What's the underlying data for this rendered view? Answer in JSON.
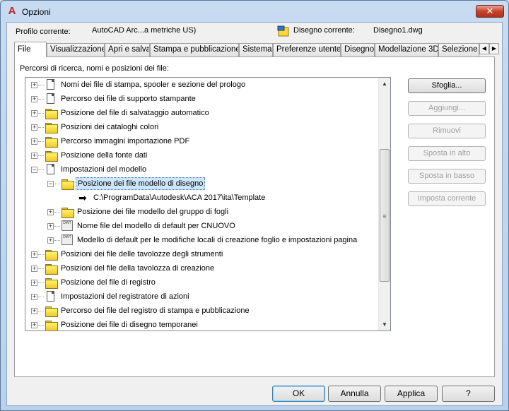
{
  "window": {
    "title": "Opzioni",
    "close_symbol": "✕",
    "app_icon_letter": "A"
  },
  "profile": {
    "label": "Profilo corrente:",
    "value": "AutoCAD Arc...a metriche US)",
    "drawing_label": "Disegno corrente:",
    "drawing_value": "Disegno1.dwg"
  },
  "tabs": [
    "File",
    "Visualizzazione",
    "Apri e salva",
    "Stampa e pubblicazione",
    "Sistema",
    "Preferenze utente",
    "Disegno",
    "Modellazione 3D",
    "Selezione"
  ],
  "tab_scroll": {
    "left": "◀",
    "right": "▶"
  },
  "section_label": "Percorsi di ricerca, nomi e posizioni dei file:",
  "tree": {
    "items": [
      {
        "label": "Nomi dei file di stampa, spooler e sezione del prologo",
        "icon": "document-icon",
        "expander": "+"
      },
      {
        "label": "Percorso dei file di supporto stampante",
        "icon": "document-icon",
        "expander": "+"
      },
      {
        "label": "Posizione del file di salvataggio automatico",
        "icon": "folder-icon",
        "expander": "+"
      },
      {
        "label": "Posizioni dei cataloghi colori",
        "icon": "folder-icon",
        "expander": "+"
      },
      {
        "label": "Percorso immagini importazione PDF",
        "icon": "folder-icon",
        "expander": "+"
      },
      {
        "label": "Posizione della fonte dati",
        "icon": "folder-icon",
        "expander": "+"
      },
      {
        "label": "Impostazioni del modello",
        "icon": "document-stack-icon",
        "expander": "−"
      },
      {
        "label": "Posizione dei file modello di disegno",
        "icon": "folder-icon",
        "expander": "−",
        "selected": true
      },
      {
        "label": "C:\\ProgramData\\Autodesk\\ACA 2017\\ita\\Template",
        "icon": "arrow-icon",
        "expander": ""
      },
      {
        "label": "Posizione dei file modello del gruppo di fogli",
        "icon": "folder-icon",
        "expander": "+"
      },
      {
        "label": "Nome file del modello di default per CNUOVO",
        "icon": "dwt-icon",
        "expander": "+"
      },
      {
        "label": "Modello di default per le modifiche locali di creazione foglio e impostazioni pagina",
        "icon": "dwt-icon",
        "expander": "+"
      },
      {
        "label": "Posizioni dei file delle tavolozze degli strumenti",
        "icon": "folder-icon",
        "expander": "+"
      },
      {
        "label": "Posizioni del file della tavolozza di creazione",
        "icon": "folder-icon",
        "expander": "+"
      },
      {
        "label": "Posizione del file di registro",
        "icon": "folder-icon",
        "expander": "+"
      },
      {
        "label": "Impostazioni del registratore di azioni",
        "icon": "document-icon",
        "expander": "+"
      },
      {
        "label": "Percorso dei file del registro di stampa e pubblicazione",
        "icon": "folder-icon",
        "expander": "+"
      },
      {
        "label": "Posizione dei file di disegno temporanei",
        "icon": "folder-icon",
        "expander": "+"
      }
    ],
    "scroll_up": "▲",
    "scroll_down": "▼",
    "thumb_grip": "≡"
  },
  "side_buttons": [
    {
      "label": "Sfoglia...",
      "enabled": true
    },
    {
      "label": "Aggiungi...",
      "enabled": false
    },
    {
      "label": "Rimuovi",
      "enabled": false
    },
    {
      "label": "Sposta in alto",
      "enabled": false
    },
    {
      "label": "Sposta in basso",
      "enabled": false
    },
    {
      "label": "Imposta corrente",
      "enabled": false
    }
  ],
  "footer": {
    "ok": "OK",
    "cancel": "Annulla",
    "apply": "Applica",
    "help": "?"
  },
  "colors": {
    "selection": "#cde6fb",
    "close_button": "#c7432b",
    "folder": "#f0c92c"
  }
}
